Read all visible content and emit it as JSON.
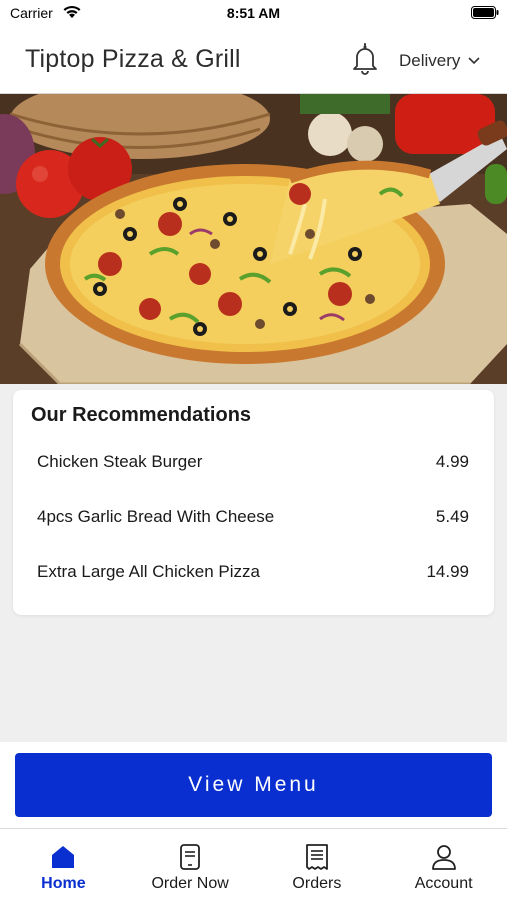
{
  "status_bar": {
    "carrier": "Carrier",
    "time": "8:51 AM"
  },
  "header": {
    "title": "Tiptop Pizza & Grill",
    "mode_label": "Delivery"
  },
  "recommendations": {
    "title": "Our Recommendations",
    "items": [
      {
        "name": "Chicken Steak Burger",
        "price": "4.99"
      },
      {
        "name": "4pcs Garlic Bread With Cheese",
        "price": "5.49"
      },
      {
        "name": "Extra Large All Chicken Pizza",
        "price": "14.99"
      }
    ]
  },
  "view_menu_label": "View Menu",
  "tabs": [
    {
      "label": "Home",
      "icon": "home-icon",
      "active": true
    },
    {
      "label": "Order Now",
      "icon": "order-now-icon",
      "active": false
    },
    {
      "label": "Orders",
      "icon": "orders-receipt-icon",
      "active": false
    },
    {
      "label": "Account",
      "icon": "account-person-icon",
      "active": false
    }
  ],
  "colors": {
    "primary": "#0a2fd0",
    "background": "#efeff0",
    "text": "#1a1a1a"
  }
}
